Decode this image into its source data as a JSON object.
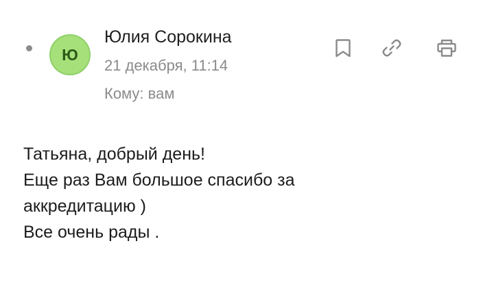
{
  "message": {
    "sender": {
      "name": "Юлия Сорокина",
      "avatar_initial": "Ю",
      "avatar_color": "#a6e07a"
    },
    "date": "21 декабря, 11:14",
    "recipient": "Кому: вам",
    "actions": {
      "bookmark_icon": "bookmark-icon",
      "link_icon": "link-icon",
      "print_icon": "printer-icon"
    },
    "body_lines": [
      "Татьяна, добрый день!",
      "Еще раз Вам большое спасибо за",
      "аккредитацию )",
      "Все очень рады ."
    ]
  }
}
